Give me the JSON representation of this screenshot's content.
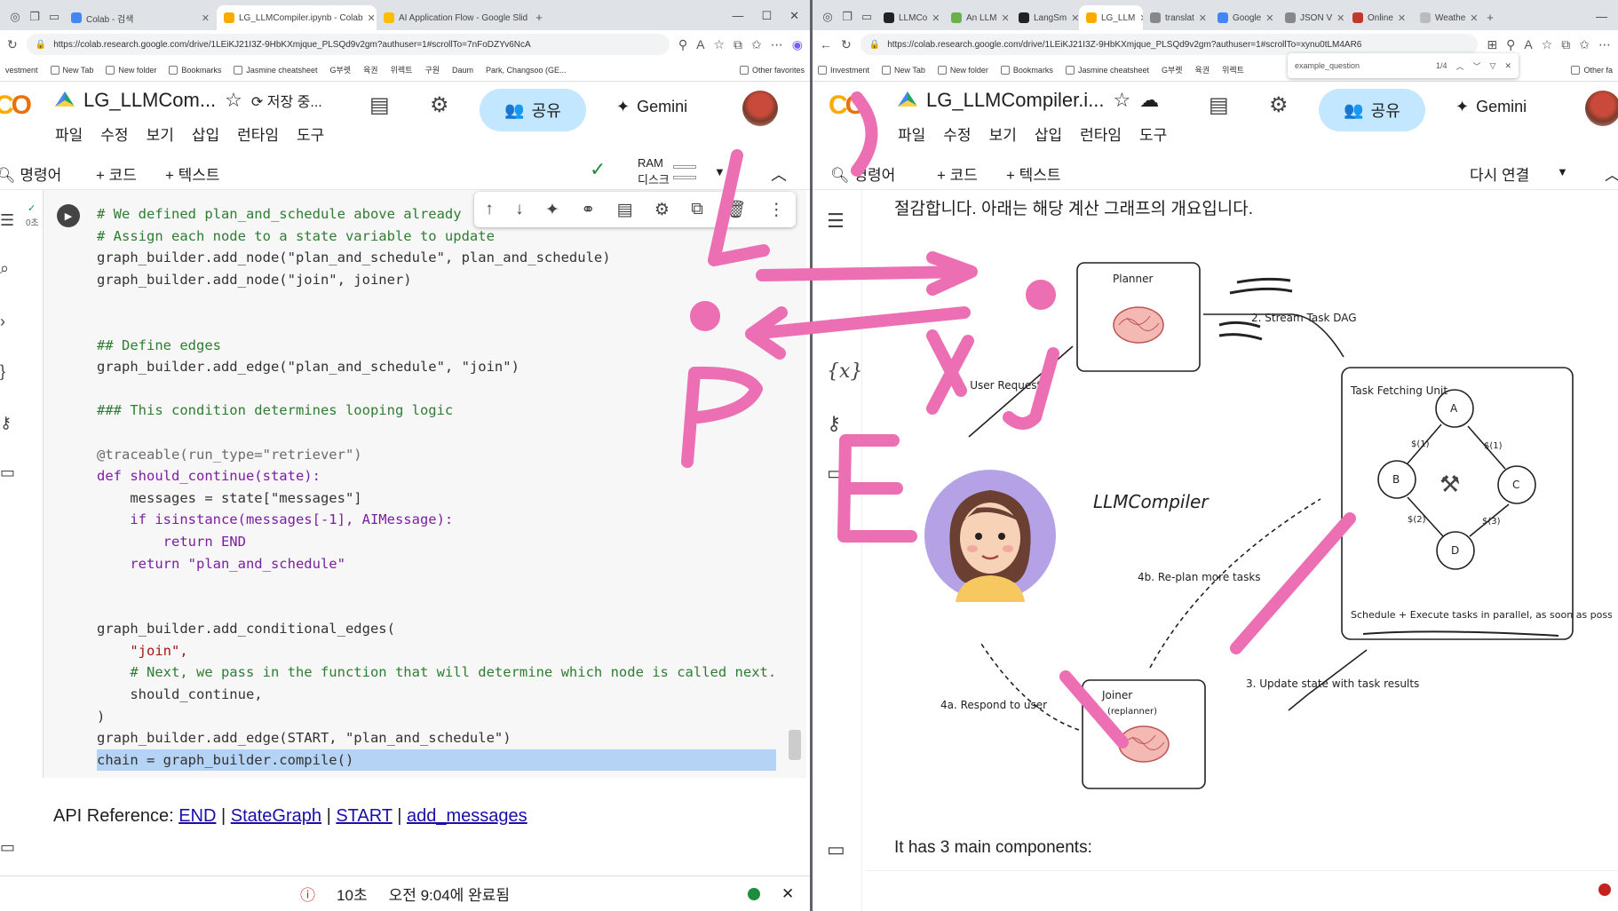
{
  "left": {
    "tabs": [
      {
        "title": "Colab - 검색",
        "active": false,
        "color": "#4285f4"
      },
      {
        "title": "LG_LLMCompiler.ipynb - Colab",
        "active": true,
        "color": "#f9ab00"
      },
      {
        "title": "AI Application Flow - Google Slid",
        "active": false,
        "color": "#fbbc04"
      }
    ],
    "url": "https://colab.research.google.com/drive/1LEiKJ21I3Z-9HbKXmjque_PLSQd9v2gm?authuser=1#scrollTo=7nFoDZYv6NcA",
    "bookmarks": [
      "vestment",
      "New Tab",
      "New folder",
      "Bookmarks",
      "Jasmine cheatsheet",
      "G부렛",
      "육권",
      "위렉트",
      "구원",
      "Daum",
      "Park, Changsoo (GE..."
    ],
    "other_favorites": "Other favorites",
    "notebook_title": "LG_LLMCom...",
    "save_status": "저장 중...",
    "menu": [
      "파일",
      "수정",
      "보기",
      "삽입",
      "런타임",
      "도구"
    ],
    "share": "공유",
    "gemini": "Gemini",
    "toolbar": {
      "commands": "명령어",
      "code": "+ 코드",
      "text": "+ 텍스트",
      "ram": "RAM",
      "disk": "디스크"
    },
    "exec_time": "0초",
    "code_lines": [
      {
        "t": "# We defined plan_and_schedule above already",
        "k": "cm"
      },
      {
        "t": "# Assign each node to a state variable to update",
        "k": "cm"
      },
      {
        "t": "graph_builder.add_node(\"plan_and_schedule\", plan_and_schedule)",
        "k": ""
      },
      {
        "t": "graph_builder.add_node(\"join\", joiner)",
        "k": ""
      },
      {
        "t": "",
        "k": ""
      },
      {
        "t": "",
        "k": ""
      },
      {
        "t": "## Define edges",
        "k": "cm"
      },
      {
        "t": "graph_builder.add_edge(\"plan_and_schedule\", \"join\")",
        "k": ""
      },
      {
        "t": "",
        "k": ""
      },
      {
        "t": "### This condition determines looping logic",
        "k": "cm"
      },
      {
        "t": "",
        "k": ""
      },
      {
        "t": "@traceable(run_type=\"retriever\")",
        "k": "dec"
      },
      {
        "t": "def should_continue(state):",
        "k": "kw"
      },
      {
        "t": "    messages = state[\"messages\"]",
        "k": ""
      },
      {
        "t": "    if isinstance(messages[-1], AIMessage):",
        "k": "kw"
      },
      {
        "t": "        return END",
        "k": "kw"
      },
      {
        "t": "    return \"plan_and_schedule\"",
        "k": "kw"
      },
      {
        "t": "",
        "k": ""
      },
      {
        "t": "",
        "k": ""
      },
      {
        "t": "graph_builder.add_conditional_edges(",
        "k": ""
      },
      {
        "t": "    \"join\",",
        "k": "st"
      },
      {
        "t": "    # Next, we pass in the function that will determine which node is called next.",
        "k": "cm"
      },
      {
        "t": "    should_continue,",
        "k": ""
      },
      {
        "t": ")",
        "k": ""
      },
      {
        "t": "graph_builder.add_edge(START, \"plan_and_schedule\")",
        "k": ""
      },
      {
        "t": "chain = graph_builder.compile()",
        "k": "sel"
      }
    ],
    "api_label": "API Reference:",
    "api_links": [
      "END",
      "StateGraph",
      "START",
      "add_messages"
    ],
    "status_time": "10초",
    "status_done": "오전 9:04에 완료됨"
  },
  "right": {
    "tabs": [
      "LLMCo",
      "An LLM",
      "LangSm",
      "LG_LLM",
      "translat",
      "Google",
      "JSON V",
      "Online",
      "Weathe"
    ],
    "url": "https://colab.research.google.com/drive/1LEiKJ21I3Z-9HbKXmjque_PLSQd9v2gm?authuser=1#scrollTo=xynu0tLM4AR6",
    "bookmarks": [
      "Investment",
      "New Tab",
      "New folder",
      "Bookmarks",
      "Jasmine cheatsheet",
      "G부렛",
      "육권",
      "위렉트"
    ],
    "other_favorites": "Other fa",
    "find_query": "example_question",
    "find_count": "1/4",
    "notebook_title": "LG_LLMCompiler.i...",
    "menu": [
      "파일",
      "수정",
      "보기",
      "삽입",
      "런타임",
      "도구"
    ],
    "share": "공유",
    "gemini": "Gemini",
    "toolbar": {
      "commands": "명령어",
      "code": "+ 코드",
      "text": "+ 텍스트",
      "reconnect": "다시 연결"
    },
    "intro": "절감합니다. 아래는 해당 계산 그래프의 개요입니다.",
    "diagram": {
      "planner": "Planner",
      "stream": "2. Stream Task DAG",
      "user_request": "1. User Request",
      "task_fetching": "Task Fetching Unit",
      "nodes": [
        "A",
        "B",
        "C",
        "D"
      ],
      "edge_labels": [
        "$(1)",
        "$(1)",
        "$(2)",
        "$(3)"
      ],
      "schedule": "Schedule + Execute tasks in parallel, as soon as possible",
      "llmcompiler": "LLMCompiler",
      "replan": "4b. Re-plan more tasks",
      "update": "3. Update state with task results",
      "respond": "4a. Respond to user",
      "joiner": "Joiner",
      "replanner": "(replanner)"
    },
    "components": "It has 3 main components:"
  },
  "colors": {
    "ink": "#ec6fb4",
    "share_bg": "#c2e7ff",
    "selection": "#b4d3f5",
    "link": "#1a0dab"
  }
}
